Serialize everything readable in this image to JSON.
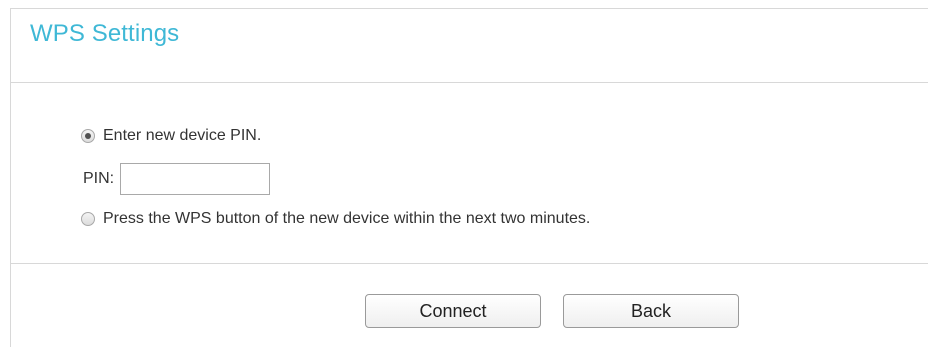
{
  "panel": {
    "title": "WPS Settings",
    "accent_color": "#3fb8d6"
  },
  "options": {
    "pin_option_label": "Enter new device PIN.",
    "pin_option_selected": true,
    "pbc_option_label": "Press the WPS button of the new device within the next two minutes.",
    "pbc_option_selected": false
  },
  "pin_field": {
    "label": "PIN:",
    "value": "",
    "placeholder": ""
  },
  "buttons": {
    "connect_label": "Connect",
    "back_label": "Back"
  }
}
